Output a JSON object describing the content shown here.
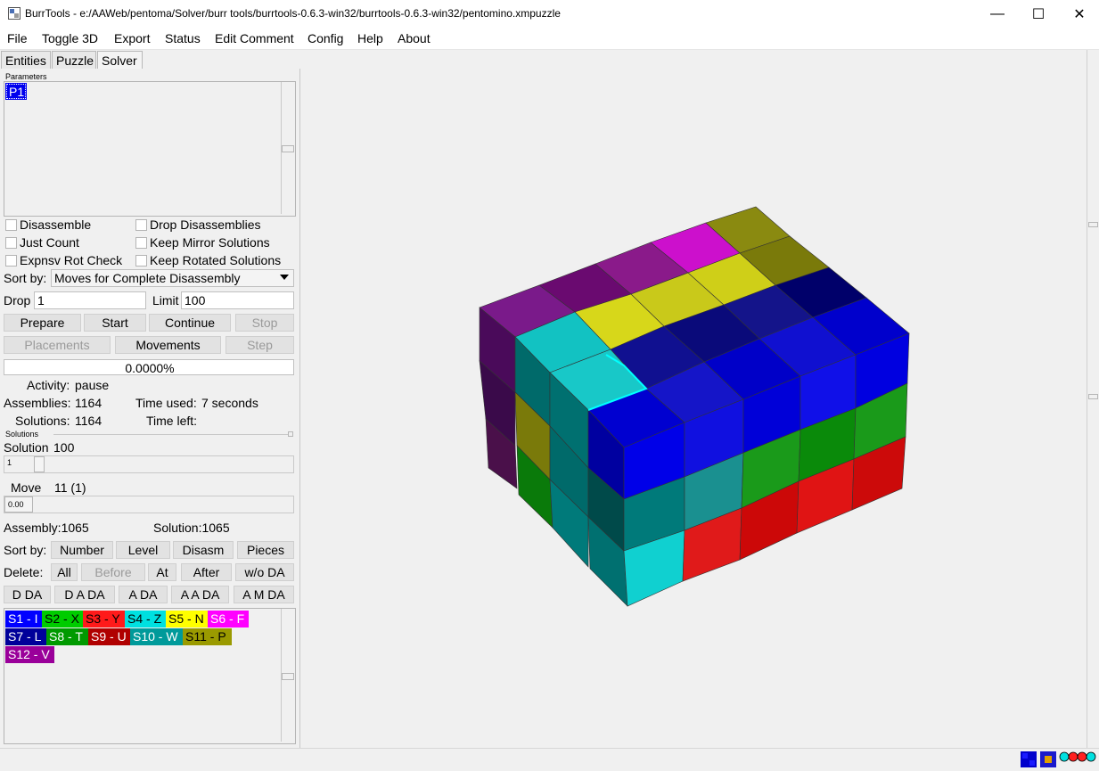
{
  "window": {
    "title": "BurrTools - e:/AAWeb/pentoma/Solver/burr tools/burrtools-0.6.3-win32/burrtools-0.6.3-win32/pentomino.xmpuzzle",
    "minimize": "—",
    "maximize": "☐",
    "close": "✕"
  },
  "menu": [
    "File",
    "Toggle 3D",
    "Export",
    "Status",
    "Edit Comment",
    "Config",
    "Help",
    "About"
  ],
  "tabs": [
    "Entities",
    "Puzzle",
    "Solver"
  ],
  "active_tab": "Solver",
  "parameters": {
    "label": "Parameters",
    "items": [
      "P1"
    ]
  },
  "options": {
    "disassemble": "Disassemble",
    "drop_disassemblies": "Drop Disassemblies",
    "just_count": "Just Count",
    "keep_mirror": "Keep Mirror Solutions",
    "expnsv_rot": "Expnsv Rot Check",
    "keep_rotated": "Keep Rotated Solutions"
  },
  "sort": {
    "label": "Sort by:",
    "value": "Moves for Complete Disassembly"
  },
  "drop": {
    "label": "Drop",
    "value": "1"
  },
  "limit": {
    "label": "Limit",
    "value": "100"
  },
  "buttons": {
    "prepare": "Prepare",
    "start": "Start",
    "continue": "Continue",
    "stop": "Stop",
    "placements": "Placements",
    "movements": "Movements",
    "step": "Step"
  },
  "progress": {
    "text": "0.0000%",
    "value": 0.0
  },
  "status": {
    "activity_label": "Activity:",
    "activity_value": "pause",
    "assemblies_label": "Assemblies:",
    "assemblies_value": "1164",
    "time_used_label": "Time used:",
    "time_used_value": "7 seconds",
    "solutions_label": "Solutions:",
    "solutions_value": "1164",
    "time_left_label": "Time left:",
    "time_left_value": ""
  },
  "solutions": {
    "label": "Solutions",
    "solution_label": "Solution",
    "solution_value": "100",
    "solution_slider_value": "1",
    "move_label": "Move",
    "move_value": "11 (1)",
    "move_slider_value": "0.00",
    "assembly_text": "Assembly:1065",
    "solution_text": "Solution:1065"
  },
  "sort2": {
    "label": "Sort by:",
    "buttons": [
      "Number",
      "Level",
      "Disasm",
      "Pieces"
    ]
  },
  "delete": {
    "label": "Delete:",
    "buttons": [
      "All",
      "Before",
      "At",
      "After",
      "w/o DA"
    ]
  },
  "da_buttons": [
    "D DA",
    "D A DA",
    "A DA",
    "A A DA",
    "A M DA"
  ],
  "shapes": [
    {
      "label": "S1 - I",
      "bg": "#0000ff",
      "fg": "#ffffff"
    },
    {
      "label": "S2 - X",
      "bg": "#00cc00",
      "fg": "#000000"
    },
    {
      "label": "S3 - Y",
      "bg": "#ff1a1a",
      "fg": "#000000"
    },
    {
      "label": "S4 - Z",
      "bg": "#00e0e0",
      "fg": "#000000"
    },
    {
      "label": "S5 - N",
      "bg": "#ffff00",
      "fg": "#000000"
    },
    {
      "label": "S6 - F",
      "bg": "#ff00ff",
      "fg": "#ffffff"
    },
    {
      "label": "S7 - L",
      "bg": "#00009a",
      "fg": "#ffffff"
    },
    {
      "label": "S8 - T",
      "bg": "#009a00",
      "fg": "#ffffff"
    },
    {
      "label": "S9 - U",
      "bg": "#b00000",
      "fg": "#ffffff"
    },
    {
      "label": "S10 - W",
      "bg": "#009a9a",
      "fg": "#ffffff"
    },
    {
      "label": "S11 - P",
      "bg": "#9a9a00",
      "fg": "#000000"
    },
    {
      "label": "S12 - V",
      "bg": "#9a009a",
      "fg": "#ffffff"
    }
  ],
  "colors": {
    "accent": "#0000ff",
    "window_bg": "#f0f0f0"
  }
}
